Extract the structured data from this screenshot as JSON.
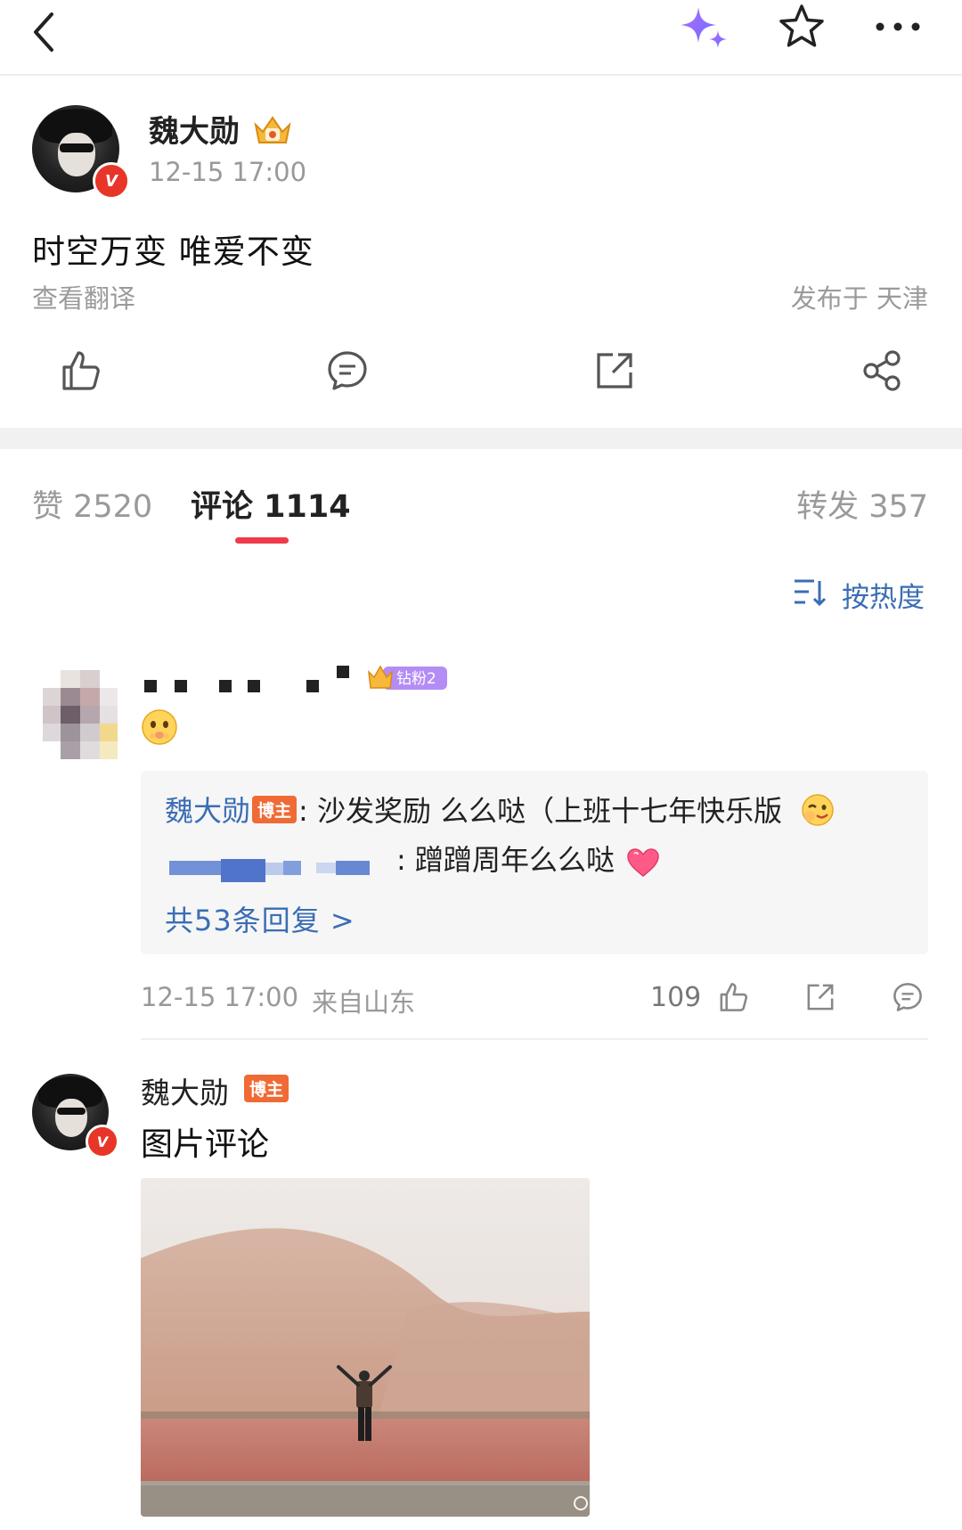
{
  "header": {
    "icons": [
      "back-icon",
      "sparkle-icon",
      "star-icon",
      "more-icon"
    ]
  },
  "post": {
    "author": "魏大勋",
    "time": "12-15 17:00",
    "text": "时空万变 唯爱不变",
    "translate_label": "查看翻译",
    "location": "发布于 天津",
    "actions": [
      "like-icon",
      "comment-icon",
      "repost-icon",
      "share-icon"
    ]
  },
  "tabs": {
    "likes": "赞 2520",
    "comments": "评论 1114",
    "reposts": "转发 357",
    "active": "comments"
  },
  "sort": {
    "label": "按热度"
  },
  "comment1": {
    "badge": "钻粉2",
    "reply1_name": "魏大勋",
    "reply1_tag": "博主",
    "reply1_text": ": 沙发奖励 么么哒（上班十七年快乐版",
    "reply1_end": "）",
    "reply2_text": ": 蹭蹭周年么么哒",
    "more_replies": "共53条回复 >",
    "time": "12-15 17:00",
    "source": "来自山东",
    "likes": "109"
  },
  "comment2": {
    "name": "魏大勋",
    "tag": "博主",
    "text": "图片评论"
  },
  "colors": {
    "accent_red": "#ee3a4a",
    "link_blue": "#3b6db4",
    "tag_orange": "#f06a35",
    "muted": "#999999"
  }
}
